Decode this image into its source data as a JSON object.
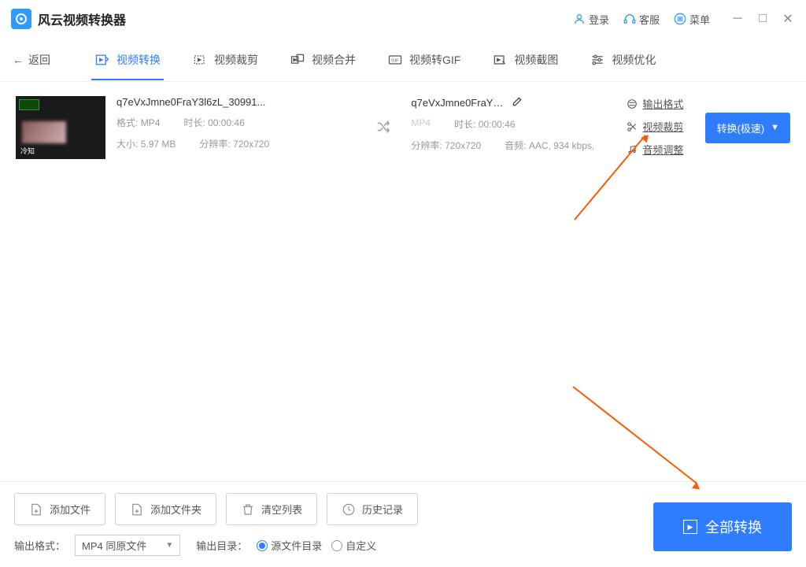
{
  "app": {
    "title": "风云视频转换器"
  },
  "titlebar": {
    "login": "登录",
    "support": "客服",
    "menu": "菜单"
  },
  "nav": {
    "back": "返回",
    "tabs": [
      {
        "label": "视频转换"
      },
      {
        "label": "视频裁剪"
      },
      {
        "label": "视频合并"
      },
      {
        "label": "视频转GIF"
      },
      {
        "label": "视频截图"
      },
      {
        "label": "视频优化"
      }
    ]
  },
  "file": {
    "name": "q7eVxJmne0FraY3l6zL_30991...",
    "format_label": "格式:",
    "format": "MP4",
    "duration_label": "时长:",
    "duration": "00:00:46",
    "size_label": "大小:",
    "size": "5.97 MB",
    "resolution_label": "分辨率:",
    "resolution": "720x720"
  },
  "output": {
    "name": "q7eVxJmne0FraY3l...",
    "format_value": "MP4",
    "duration_label": "时长:",
    "duration": "00:00:46",
    "resolution_label": "分辨率:",
    "resolution": "720x720",
    "audio_label": "音频:",
    "audio": "AAC, 934 kbps,"
  },
  "options": {
    "output_format": "输出格式",
    "video_crop": "视频裁剪",
    "audio_adjust": "音频调整"
  },
  "actions": {
    "convert_speed": "转换(极速)",
    "convert_all": "全部转换"
  },
  "bottom_buttons": {
    "add_file": "添加文件",
    "add_folder": "添加文件夹",
    "clear_list": "清空列表",
    "history": "历史记录"
  },
  "settings": {
    "output_format_label": "输出格式：",
    "output_format_value": "MP4 同原文件",
    "output_dir_label": "输出目录：",
    "source_dir": "源文件目录",
    "custom": "自定义"
  }
}
